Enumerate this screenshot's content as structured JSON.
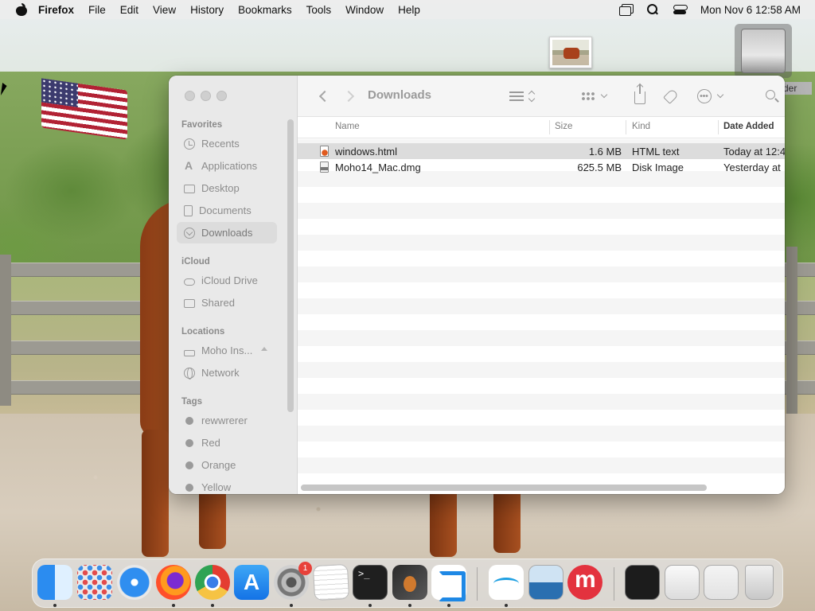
{
  "menubar": {
    "app_name": "Firefox",
    "items": [
      "File",
      "Edit",
      "View",
      "History",
      "Bookmarks",
      "Tools",
      "Window",
      "Help"
    ],
    "clock": "Mon Nov 6  12:58 AM",
    "status_icons": [
      "windows-icon",
      "search-icon",
      "control-center-icon"
    ]
  },
  "desktop": {
    "drive_label_partial": "der"
  },
  "finder": {
    "title": "Downloads",
    "sidebar": {
      "favorites_header": "Favorites",
      "favorites": [
        {
          "label": "Recents",
          "icon": "clock-icon"
        },
        {
          "label": "Applications",
          "icon": "applications-icon"
        },
        {
          "label": "Desktop",
          "icon": "desktop-icon"
        },
        {
          "label": "Documents",
          "icon": "document-icon"
        },
        {
          "label": "Downloads",
          "icon": "download-icon",
          "selected": true
        }
      ],
      "icloud_header": "iCloud",
      "icloud": [
        {
          "label": "iCloud Drive",
          "icon": "cloud-icon"
        },
        {
          "label": "Shared",
          "icon": "shared-folder-icon"
        }
      ],
      "locations_header": "Locations",
      "locations": [
        {
          "label": "Moho Ins...",
          "icon": "drive-icon",
          "ejectable": true
        },
        {
          "label": "Network",
          "icon": "globe-icon"
        }
      ],
      "tags_header": "Tags",
      "tags": [
        {
          "label": "rewwrerer",
          "color": "#9a9a9a"
        },
        {
          "label": "Red",
          "color": "#9a9a9a"
        },
        {
          "label": "Orange",
          "color": "#9a9a9a"
        },
        {
          "label": "Yellow",
          "color": "#9a9a9a"
        }
      ]
    },
    "columns": {
      "name": "Name",
      "size": "Size",
      "kind": "Kind",
      "date_added": "Date Added",
      "sorted_by": "Date Added"
    },
    "files": [
      {
        "name": "windows.html",
        "size": "1.6 MB",
        "kind": "HTML text",
        "date_added": "Today at 12:4",
        "icon": "html-file-icon",
        "selected": true
      },
      {
        "name": "Moho14_Mac.dmg",
        "size": "625.5 MB",
        "kind": "Disk Image",
        "date_added": "Yesterday at",
        "icon": "disk-image-icon",
        "selected": false
      }
    ]
  },
  "dock": {
    "apps": [
      {
        "name": "Finder",
        "running": true
      },
      {
        "name": "Launchpad",
        "running": false
      },
      {
        "name": "Safari",
        "running": false
      },
      {
        "name": "Firefox",
        "running": true
      },
      {
        "name": "Google Chrome",
        "running": true
      },
      {
        "name": "App Store",
        "running": false
      },
      {
        "name": "System Settings",
        "running": true,
        "badge": "1"
      },
      {
        "name": "TextEdit",
        "running": false
      },
      {
        "name": "Terminal",
        "running": true
      },
      {
        "name": "GarageBand",
        "running": true
      },
      {
        "name": "Visual Studio Code",
        "running": true
      },
      {
        "name": "Freeform",
        "running": true
      },
      {
        "name": "Preview",
        "running": false
      },
      {
        "name": "Moho",
        "running": false
      }
    ],
    "badge_settings": "1"
  }
}
